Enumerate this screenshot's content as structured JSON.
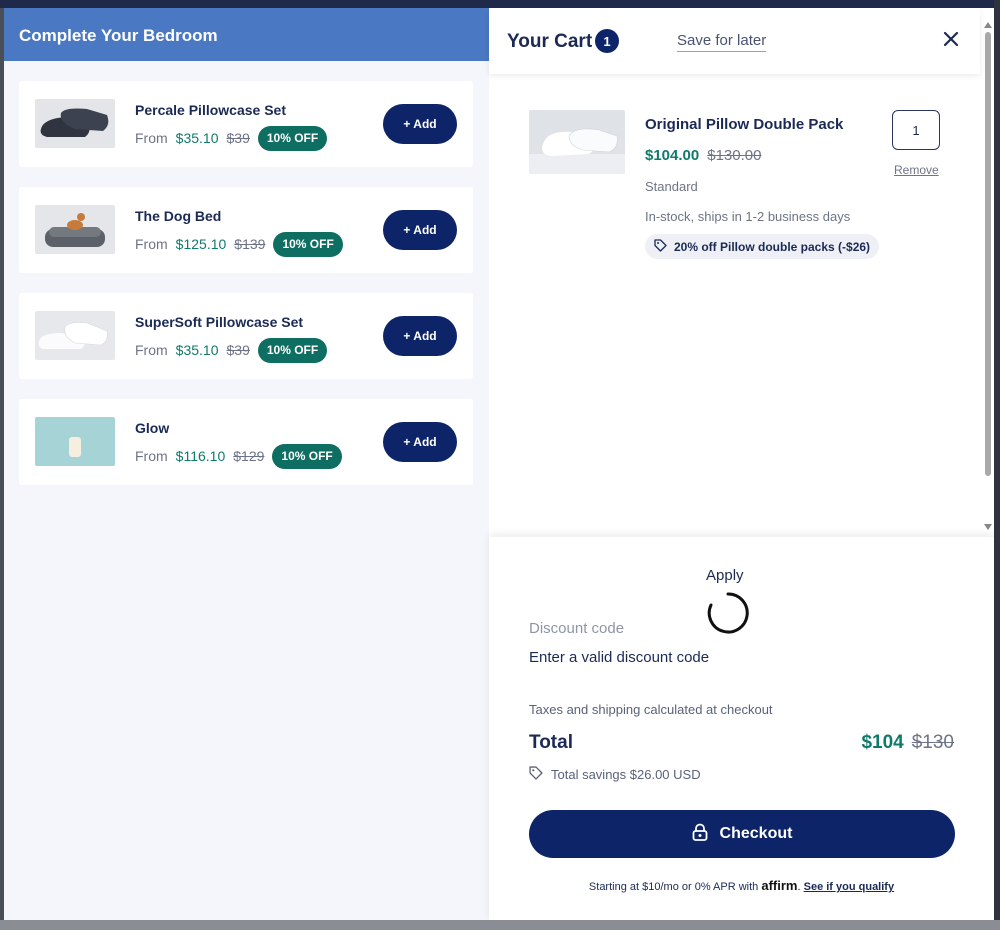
{
  "recommendations": {
    "title": "Complete Your Bedroom",
    "items": [
      {
        "name": "Percale Pillowcase Set",
        "from": "From",
        "price": "$35.10",
        "original": "$39",
        "badge": "10% OFF",
        "add_label": "+ Add"
      },
      {
        "name": "The Dog Bed",
        "from": "From",
        "price": "$125.10",
        "original": "$139",
        "badge": "10% OFF",
        "add_label": "+ Add"
      },
      {
        "name": "SuperSoft Pillowcase Set",
        "from": "From",
        "price": "$35.10",
        "original": "$39",
        "badge": "10% OFF",
        "add_label": "+ Add"
      },
      {
        "name": "Glow",
        "from": "From",
        "price": "$116.10",
        "original": "$129",
        "badge": "10% OFF",
        "add_label": "+ Add"
      }
    ]
  },
  "cart": {
    "title": "Your Cart",
    "count": "1",
    "save_for_later": "Save for later",
    "item": {
      "name": "Original Pillow Double Pack",
      "price": "$104.00",
      "original": "$130.00",
      "variant": "Standard",
      "stock": "In-stock, ships in 1-2 business days",
      "promo": "20% off Pillow double packs (-$26)",
      "quantity": "1",
      "remove_label": "Remove"
    }
  },
  "summary": {
    "apply_label": "Apply",
    "discount_label": "Discount code",
    "discount_error": "Enter a valid discount code",
    "tax_note": "Taxes and shipping calculated at checkout",
    "total_label": "Total",
    "total_price": "$104",
    "total_original": "$130",
    "savings": "Total savings $26.00 USD",
    "checkout_label": "Checkout",
    "affirm_prefix": "Starting at $10/mo or 0% APR with",
    "affirm_brand": "affirm",
    "affirm_link": "See if you qualify"
  },
  "colors": {
    "navy": "#0d2568",
    "teal": "#0f6e62",
    "header_blue": "#4a78c2"
  }
}
